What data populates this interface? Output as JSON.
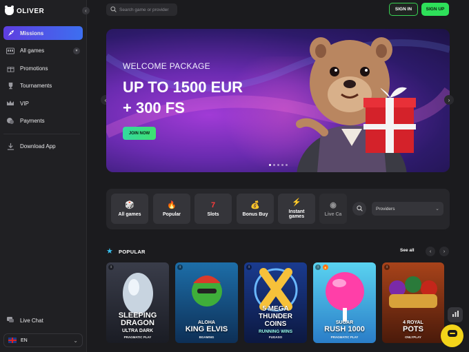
{
  "brand": {
    "name": "OLIVER"
  },
  "sidebar": {
    "items": [
      {
        "label": "Missions",
        "icon": "rocket-icon"
      },
      {
        "label": "All games",
        "icon": "slots-icon"
      },
      {
        "label": "Promotions",
        "icon": "gift-icon"
      },
      {
        "label": "Tournaments",
        "icon": "trophy-icon"
      },
      {
        "label": "VIP",
        "icon": "crown-icon"
      },
      {
        "label": "Payments",
        "icon": "coins-icon"
      }
    ],
    "download_label": "Download App",
    "live_chat_label": "Live Chat",
    "language": "EN"
  },
  "topbar": {
    "search_placeholder": "Search game or provider",
    "signin_label": "SIGN IN",
    "signup_label": "SIGN UP"
  },
  "banner": {
    "subtitle": "WELCOME PACKAGE",
    "title_line1": "UP TO 1500 EUR",
    "title_line2": "+ 300 FS",
    "cta_label": "JOIN NOW",
    "slides": 5,
    "active_slide": 0
  },
  "filters": {
    "categories": [
      {
        "label": "All games",
        "icon": "dice-icon"
      },
      {
        "label": "Popular",
        "icon": "fire-icon"
      },
      {
        "label": "Slots",
        "icon": "seven-icon"
      },
      {
        "label": "Bonus Buy",
        "icon": "moneybag-icon"
      },
      {
        "label": "Instant games",
        "icon": "lightning-icon"
      },
      {
        "label": "Live Ca",
        "icon": "roulette-icon"
      }
    ],
    "providers_label": "Providers"
  },
  "popular": {
    "title": "POPULAR",
    "see_all": "See all",
    "games": [
      {
        "name_top": "SLEEPING",
        "name_mid": "DRAGON",
        "name_bottom": "ULTRA DARK",
        "provider": "PRAGMATIC PLAY",
        "colors": [
          "#3a3d4a",
          "#1a1c24"
        ]
      },
      {
        "name_top": "ALOHA",
        "name_mid": "KING ELVIS",
        "name_bottom": "",
        "provider": "BGAMING",
        "colors": [
          "#1d6ea8",
          "#0d2f56"
        ]
      },
      {
        "name_top": "5 MEGA",
        "name_mid": "THUNDER",
        "name_bottom": "COINS",
        "sub": "RUNNING WINS",
        "provider": "FUGASO",
        "colors": [
          "#1a3b8f",
          "#0c1840"
        ]
      },
      {
        "name_top": "SUGAR",
        "name_mid": "RUSH 1000",
        "name_bottom": "",
        "provider": "PRAGMATIC PLAY",
        "colors": [
          "#5ad3f0",
          "#2a7dc8"
        ]
      },
      {
        "name_top": "4 ROYAL",
        "name_mid": "POTS",
        "name_bottom": "",
        "provider": "ONLYPLAY",
        "colors": [
          "#a8431a",
          "#4a1a0a"
        ]
      }
    ]
  },
  "colors": {
    "accent": "#2ee05a",
    "active_nav": "#5e3ee0",
    "chat": "#f3d41a"
  }
}
